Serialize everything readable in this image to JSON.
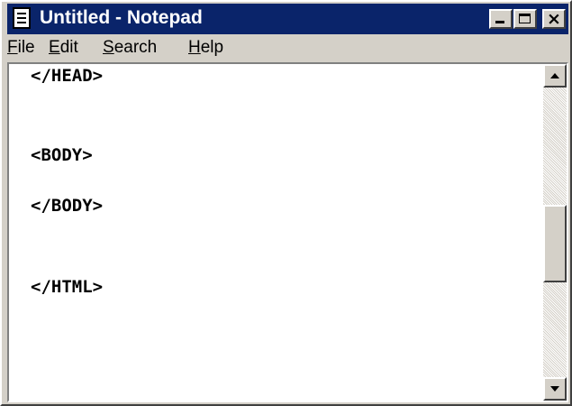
{
  "window": {
    "title": "Untitled - Notepad",
    "colors": {
      "titlebar": "#0a246a",
      "face": "#d4d0c8"
    }
  },
  "title_buttons": {
    "minimize": "minimize",
    "maximize": "maximize",
    "close": "×"
  },
  "menu": {
    "file": {
      "mnemonic": "F",
      "rest": "ile"
    },
    "edit": {
      "mnemonic": "E",
      "rest": "dit"
    },
    "search": {
      "mnemonic": "S",
      "rest": "earch"
    },
    "help": {
      "mnemonic": "H",
      "rest": "elp"
    }
  },
  "editor": {
    "lines": [
      "</HEAD>",
      "<BODY>",
      "</BODY>",
      "</HTML>"
    ]
  },
  "scrollbar": {
    "position_fraction": 0.5
  }
}
